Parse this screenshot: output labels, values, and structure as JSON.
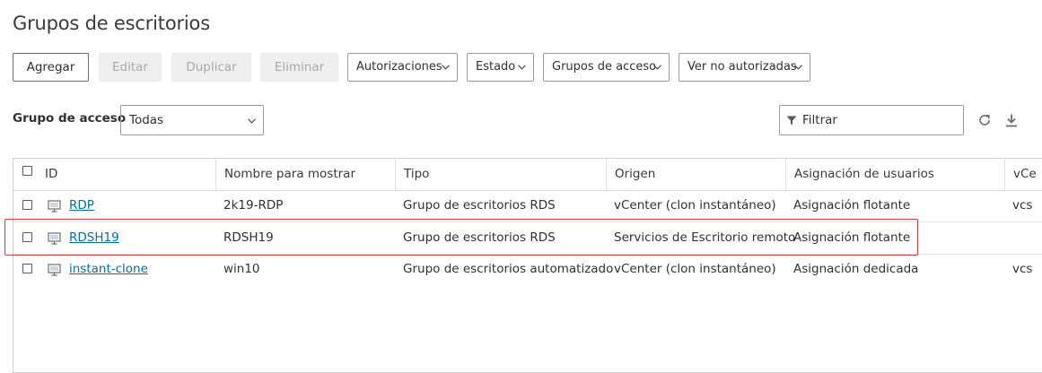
{
  "page": {
    "title": "Grupos de escritorios"
  },
  "toolbar": {
    "add_label": "Agregar",
    "edit_label": "Editar",
    "duplicate_label": "Duplicar",
    "delete_label": "Eliminar",
    "entitlements_label": "Autorizaciones",
    "status_label": "Estado",
    "access_groups_label": "Grupos de acceso",
    "unauthorized_label": "Ver no autorizadas"
  },
  "access_group": {
    "label": "Grupo de acceso",
    "value": "Todas"
  },
  "filter": {
    "placeholder": "Filtrar",
    "icon": "filter-icon"
  },
  "icons": {
    "refresh": "refresh-icon",
    "download": "download-icon",
    "pool": "monitor-icon",
    "dropdown": "chevron-down-icon"
  },
  "table": {
    "columns": [
      "ID",
      "Nombre para mostrar",
      "Tipo",
      "Origen",
      "Asignación de usuarios",
      "vCe"
    ],
    "rows": [
      {
        "id": "RDP",
        "display_name": "2k19-RDP",
        "type": "Grupo de escritorios RDS",
        "source": "vCenter (clon instantáneo)",
        "assignment": "Asignación flotante",
        "vcenter": "vcs"
      },
      {
        "id": "RDSH19",
        "display_name": "RDSH19",
        "type": "Grupo de escritorios RDS",
        "source": "Servicios de Escritorio remoto",
        "assignment": "Asignación flotante",
        "vcenter": ""
      },
      {
        "id": "instant-clone",
        "display_name": "win10",
        "type": "Grupo de escritorios automatizado",
        "source": "vCenter (clon instantáneo)",
        "assignment": "Asignación dedicada",
        "vcenter": "vcs"
      }
    ]
  },
  "colors": {
    "link": "#0072a3",
    "highlight": "#d8383f",
    "border": "#cfcfcf"
  }
}
